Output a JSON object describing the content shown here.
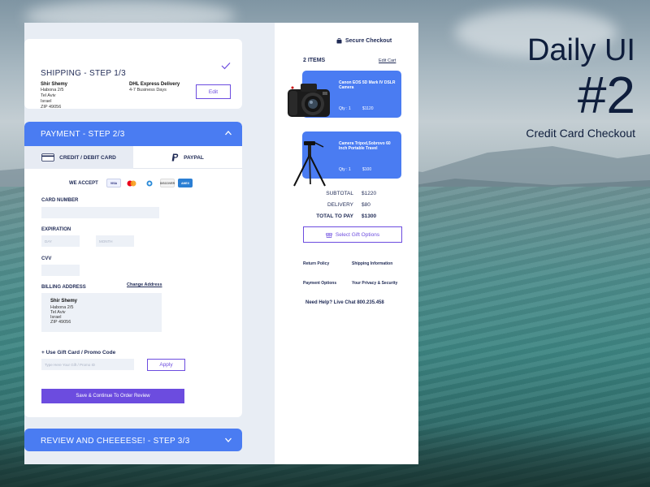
{
  "header": {
    "title_line1": "Daily UI",
    "title_line2": "#2",
    "subtitle": "Credit Card Checkout"
  },
  "shipping": {
    "step_title": "SHIPPING - STEP 1/3",
    "name": "Shir Shemy",
    "address_lines": [
      "Habona 2/5",
      "Tel Aviv",
      "Israel",
      "ZIP 49056"
    ],
    "carrier": "DHL Express Delivery",
    "eta": "4-7 Business Days",
    "edit_label": "Edit"
  },
  "payment": {
    "step_title": "PAYMENT - STEP 2/3",
    "tabs": [
      {
        "label": "CREDIT / DEBIT CARD",
        "icon": "credit-card-icon"
      },
      {
        "label": "PAYPAL",
        "icon": "paypal-icon"
      }
    ],
    "we_accept": "WE ACCEPT",
    "brands": [
      "VISA",
      "MC",
      "AE",
      "DISCOVER",
      "AMEX"
    ],
    "card_number_label": "CARD NUMBER",
    "expiration_label": "EXPIRATION",
    "day_placeholder": "DAY",
    "month_placeholder": "MONTH",
    "cvv_label": "CVV",
    "billing_label": "BILLING ADDRESS",
    "change_address": "Change Address",
    "billing_name": "Shir Shemy",
    "billing_lines": [
      "Habona 2/5",
      "Tel Aviv",
      "Israel",
      "ZIP 49056"
    ],
    "gift_promo_label": "+  Use Gift Card / Promo Code",
    "promo_placeholder": "Type Here Your Gift / Promo ID",
    "apply_label": "Apply",
    "continue_label": "Save & Continue To Order Review"
  },
  "review": {
    "step_title": "REVIEW AND CHEEEESE! - STEP 3/3"
  },
  "cart": {
    "secure_label": "Secure Checkout",
    "items_count": "2 ITEMS",
    "edit_cart": "Edit Cart",
    "items": [
      {
        "name": "Canon EOS 5D Mark IV DSLR Camera",
        "qty": "Qty : 1",
        "price": "$1120"
      },
      {
        "name": "Camera Tripod,Sobrovo 60 Inch Portable Travel",
        "qty": "Qty : 1",
        "price": "$100"
      }
    ],
    "subtotal_label": "SUBTOTAL",
    "subtotal": "$1220",
    "delivery_label": "DELIVERY",
    "delivery": "$80",
    "total_label": "TOTAL TO PAY",
    "total": "$1300",
    "gift_options": "Select Gift Options",
    "links": [
      "Return Policy",
      "Shipping Information",
      "Payment Options",
      "Your Privacy & Security"
    ],
    "help": "Need Help? Live Chat 800.235.458"
  },
  "colors": {
    "accent_blue": "#4a7cf2",
    "accent_purple": "#6c4cdf",
    "navy": "#1f2a55"
  }
}
